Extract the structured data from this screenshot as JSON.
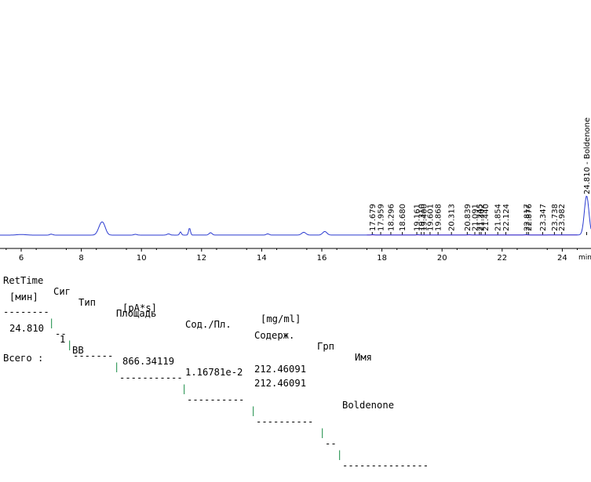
{
  "chromatogram": {
    "x_axis": {
      "ticks": [
        "6",
        "8",
        "10",
        "12",
        "14",
        "16",
        "18",
        "20",
        "22",
        "24"
      ],
      "unit": "min"
    },
    "peaks": [
      {
        "label": "17.679",
        "rt": 17.679,
        "height": 0.6
      },
      {
        "label": "17.959",
        "rt": 17.959,
        "height": 0.5
      },
      {
        "label": "18.296",
        "rt": 18.296,
        "height": 0.4
      },
      {
        "label": "18.680",
        "rt": 18.68,
        "height": 0.4
      },
      {
        "label": "19.161",
        "rt": 19.161,
        "height": 0.4
      },
      {
        "label": "19.310",
        "rt": 19.31,
        "height": 0.4
      },
      {
        "label": "19.400",
        "rt": 19.4,
        "height": 0.4
      },
      {
        "label": "19.601",
        "rt": 19.601,
        "height": 0.4
      },
      {
        "label": "19.868",
        "rt": 19.868,
        "height": 0.4
      },
      {
        "label": "20.313",
        "rt": 20.313,
        "height": 0.4
      },
      {
        "label": "20.839",
        "rt": 20.839,
        "height": 0.4
      },
      {
        "label": "21.091",
        "rt": 21.091,
        "height": 0.4
      },
      {
        "label": "21.245",
        "rt": 21.245,
        "height": 0.4
      },
      {
        "label": "21.302",
        "rt": 21.302,
        "height": 0.4
      },
      {
        "label": "21.440",
        "rt": 21.44,
        "height": 0.4
      },
      {
        "label": "21.854",
        "rt": 21.854,
        "height": 0.4
      },
      {
        "label": "22.124",
        "rt": 22.124,
        "height": 0.4
      },
      {
        "label": "22.817",
        "rt": 22.817,
        "height": 0.4
      },
      {
        "label": "22.876",
        "rt": 22.876,
        "height": 0.4
      },
      {
        "label": "23.347",
        "rt": 23.347,
        "height": 0.4
      },
      {
        "label": "23.738",
        "rt": 23.738,
        "height": 0.4
      },
      {
        "label": "23.982",
        "rt": 23.982,
        "height": 0.4
      },
      {
        "label": "24.810 - Boldenone",
        "rt": 24.81,
        "height": 50
      }
    ],
    "colors": {
      "signal": "#2a3ad0",
      "baseline": "#b030c0",
      "axis": "#000000"
    }
  },
  "report": {
    "header": {
      "retTime": "RetTime",
      "sig": "Сиг",
      "type": "Тип",
      "area": "Площадь",
      "ratio": "Сод./Пл.",
      "content": "Содерж.",
      "group": "Грп",
      "name": "Имя"
    },
    "units": {
      "retTime": "[мин]",
      "area": "[pA*s]",
      "content": "[mg/ml]"
    },
    "separators": [
      "--------",
      "--",
      "-------",
      "-----------",
      "----------",
      "----------",
      "--",
      "---------------"
    ],
    "rows": [
      {
        "retTime": "24.810",
        "sig": "1",
        "type": "BB",
        "area": "866.34119",
        "ratio": "1.16781e-2",
        "content": "212.46091",
        "group": "",
        "name": "Boldenone"
      }
    ],
    "total_label": "Всего :",
    "total_value": "212.46091"
  }
}
